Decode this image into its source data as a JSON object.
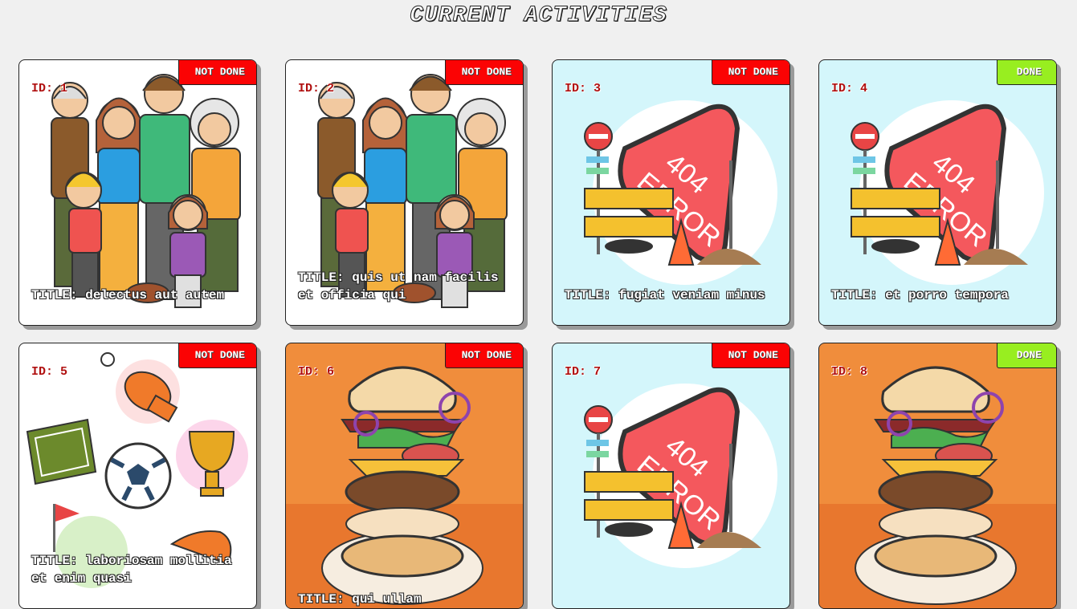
{
  "page": {
    "title": "CURRENT ACTIVITIES"
  },
  "labels": {
    "id_prefix": "ID: ",
    "title_prefix": "TITLE: "
  },
  "colors": {
    "not_done": "#fb0304",
    "done": "#98ee20",
    "card_border": "#222222",
    "shadow": "#9a9a9a"
  },
  "cards": [
    {
      "id": "1",
      "title": "delectus aut autem",
      "status": "NOT DONE",
      "done": false,
      "art": "family-illustration"
    },
    {
      "id": "2",
      "title": "quis ut nam facilis et officia qui",
      "status": "NOT DONE",
      "done": false,
      "art": "family-illustration"
    },
    {
      "id": "3",
      "title": "fugiat veniam minus",
      "status": "NOT DONE",
      "done": false,
      "art": "404-error-illustration"
    },
    {
      "id": "4",
      "title": "et porro tempora",
      "status": "DONE",
      "done": true,
      "art": "404-error-illustration"
    },
    {
      "id": "5",
      "title": "laboriosam mollitia et enim quasi",
      "status": "NOT DONE",
      "done": false,
      "art": "sports-illustration"
    },
    {
      "id": "6",
      "title": "qui ullam",
      "status": "NOT DONE",
      "done": false,
      "art": "burger-illustration"
    },
    {
      "id": "7",
      "title": "",
      "status": "NOT DONE",
      "done": false,
      "art": "404-error-illustration"
    },
    {
      "id": "8",
      "title": "",
      "status": "DONE",
      "done": true,
      "art": "burger-illustration"
    }
  ]
}
